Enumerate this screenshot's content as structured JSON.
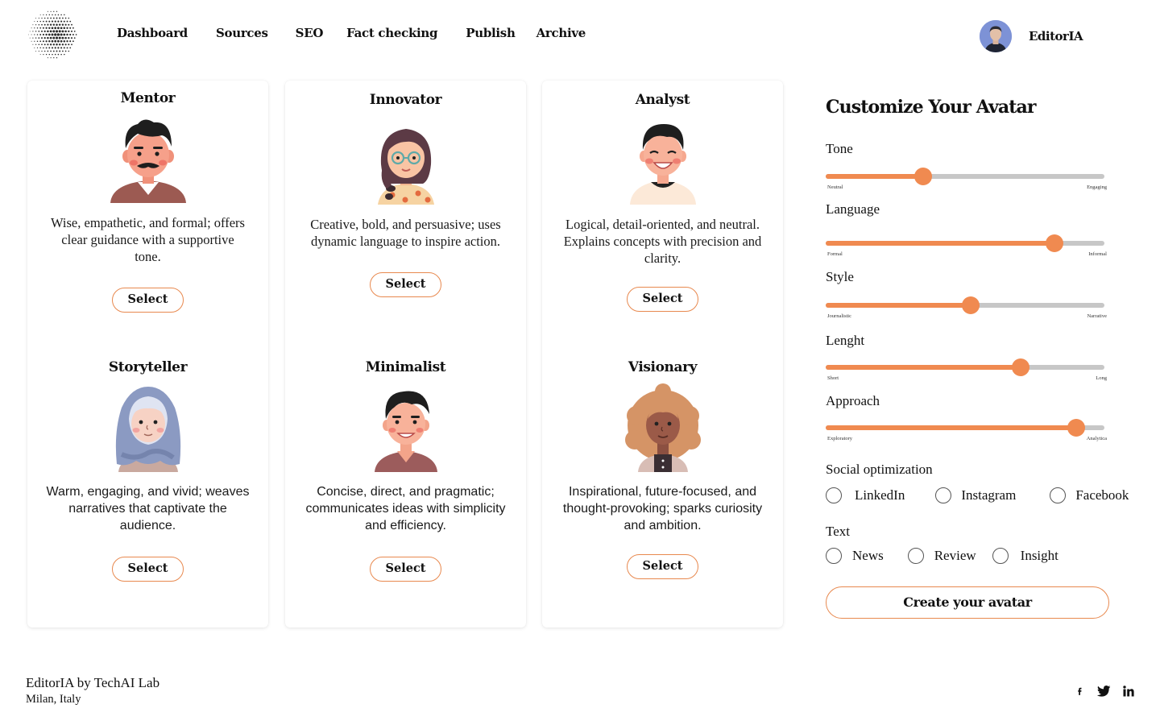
{
  "app": {
    "name": "EditorIA"
  },
  "nav": {
    "items": [
      {
        "label": "Dashboard",
        "id": "dashboard"
      },
      {
        "label": "Sources",
        "id": "sources"
      },
      {
        "label": "SEO",
        "id": "seo"
      },
      {
        "label": "Fact checking",
        "id": "fact-checking"
      },
      {
        "label": "Publish",
        "id": "publish"
      },
      {
        "label": "Archive",
        "id": "archive"
      }
    ]
  },
  "profile": {
    "name": "EditorIA"
  },
  "personas": [
    {
      "name": "Mentor",
      "description": "Wise, empathetic, and formal; offers clear guidance with a supportive tone.",
      "button": "Select"
    },
    {
      "name": "Innovator",
      "description": "Creative, bold, and persuasive; uses dynamic language to inspire action.",
      "button": "Select"
    },
    {
      "name": "Analyst",
      "description": "Logical, detail-oriented, and neutral. Explains concepts with precision and clarity.",
      "button": "Select"
    },
    {
      "name": "Storyteller",
      "description": "Warm, engaging, and vivid; weaves narratives that captivate the audience.",
      "button": "Select"
    },
    {
      "name": "Minimalist",
      "description": "Concise, direct, and pragmatic; communicates ideas with simplicity and efficiency.",
      "button": "Select"
    },
    {
      "name": "Visionary",
      "description": "Inspirational, future-focused, and thought-provoking; sparks curiosity and ambition.",
      "button": "Select"
    }
  ],
  "customize": {
    "title": "Customize Your Avatar",
    "sliders": [
      {
        "label": "Tone",
        "min_label": "Neutral",
        "max_label": "Engaging",
        "value": 0.35
      },
      {
        "label": "Language",
        "min_label": "Formal",
        "max_label": "Informal",
        "value": 0.82
      },
      {
        "label": "Style",
        "min_label": "Journalistic",
        "max_label": "Narrative",
        "value": 0.52
      },
      {
        "label": "Lenght",
        "min_label": "Short",
        "max_label": "Long",
        "value": 0.7
      },
      {
        "label": "Approach",
        "min_label": "Exploratory",
        "max_label": "Analytica",
        "value": 0.9
      }
    ],
    "social": {
      "label": "Social optimization",
      "options": [
        "LinkedIn",
        "Instagram",
        "Facebook"
      ]
    },
    "text": {
      "label": "Text",
      "options": [
        "News",
        "Review",
        "Insight"
      ]
    },
    "create_button": "Create your avatar"
  },
  "footer": {
    "brand": "EditorIA by TechAI Lab",
    "location": "Milan, Italy",
    "socials": [
      "facebook-icon",
      "twitter-icon",
      "linkedin-icon"
    ]
  },
  "colors": {
    "accent": "#f08a50",
    "track": "#c7c7c7"
  }
}
